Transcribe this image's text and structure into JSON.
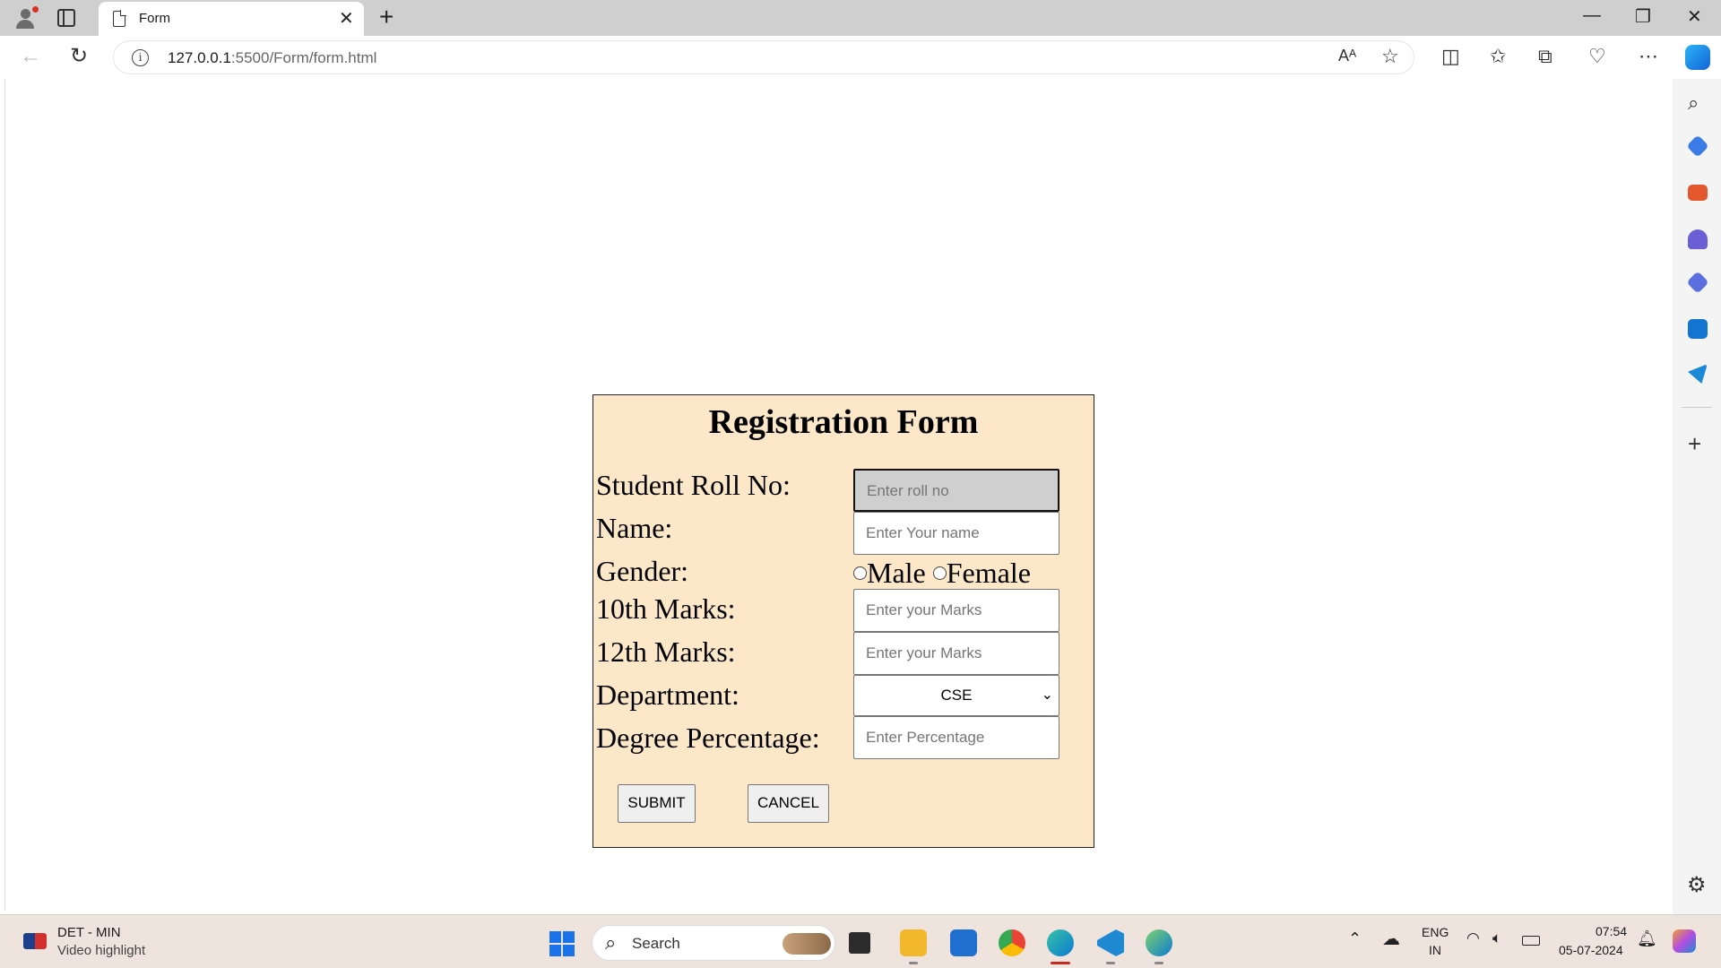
{
  "browser": {
    "tab_title": "Form",
    "url_host": "127.0.0.1",
    "url_path": ":5500/Form/form.html"
  },
  "form": {
    "title": "Registration Form",
    "roll_label": "Student Roll No:",
    "roll_placeholder": "Enter roll no",
    "name_label": "Name:",
    "name_placeholder": "Enter Your name",
    "gender_label": "Gender:",
    "gender_male": "Male",
    "gender_female": "Female",
    "marks10_label": "10th Marks:",
    "marks10_placeholder": "Enter your Marks",
    "marks12_label": "12th Marks:",
    "marks12_placeholder": "Enter your Marks",
    "department_label": "Department:",
    "department_value": "CSE",
    "degree_label": "Degree Percentage:",
    "degree_placeholder": "Enter Percentage",
    "submit_label": "SUBMIT",
    "cancel_label": "CANCEL"
  },
  "taskbar": {
    "news_title": "DET - MIN",
    "news_sub": "Video highlight",
    "search_label": "Search",
    "lang_top": "ENG",
    "lang_bottom": "IN",
    "time": "07:54",
    "date": "05-07-2024"
  },
  "icons": {
    "accent": "#1a73e8",
    "edge_blue": "#0c7bd1",
    "chrome_red": "#ea4335",
    "vscode_blue": "#1f8ad2"
  }
}
